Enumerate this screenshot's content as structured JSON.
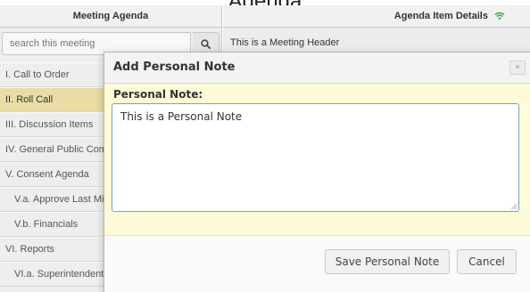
{
  "page_title": "Agenda",
  "left_pane": {
    "header": "Meeting Agenda",
    "search_placeholder": "search this meeting",
    "search_icon": "search-icon",
    "items": [
      {
        "label": "I. Call to Order",
        "sub": false,
        "active": false
      },
      {
        "label": "II. Roll Call",
        "sub": false,
        "active": true
      },
      {
        "label": "III. Discussion Items",
        "sub": false,
        "active": false
      },
      {
        "label": "IV. General Public Comment",
        "sub": false,
        "active": false
      },
      {
        "label": "V. Consent Agenda",
        "sub": false,
        "active": false
      },
      {
        "label": "V.a. Approve Last Minutes",
        "sub": true,
        "active": false
      },
      {
        "label": "V.b. Financials",
        "sub": true,
        "active": false
      },
      {
        "label": "VI. Reports",
        "sub": false,
        "active": false
      },
      {
        "label": "VI.a. Superintendent",
        "sub": true,
        "active": false
      }
    ]
  },
  "right_pane": {
    "header": "Agenda Item Details",
    "header_icon": "wifi-icon",
    "meeting_header": "This is a Meeting Header"
  },
  "dialog": {
    "title": "Add Personal Note",
    "close_label": "×",
    "note_label": "Personal Note:",
    "note_value": "This is a Personal Note",
    "save_label": "Save Personal Note",
    "cancel_label": "Cancel"
  },
  "colors": {
    "active_item": "#e9dca4",
    "dialog_body": "#fdfbd8",
    "textarea_border": "#6aa3d6",
    "wifi_icon": "#3aa64c"
  }
}
